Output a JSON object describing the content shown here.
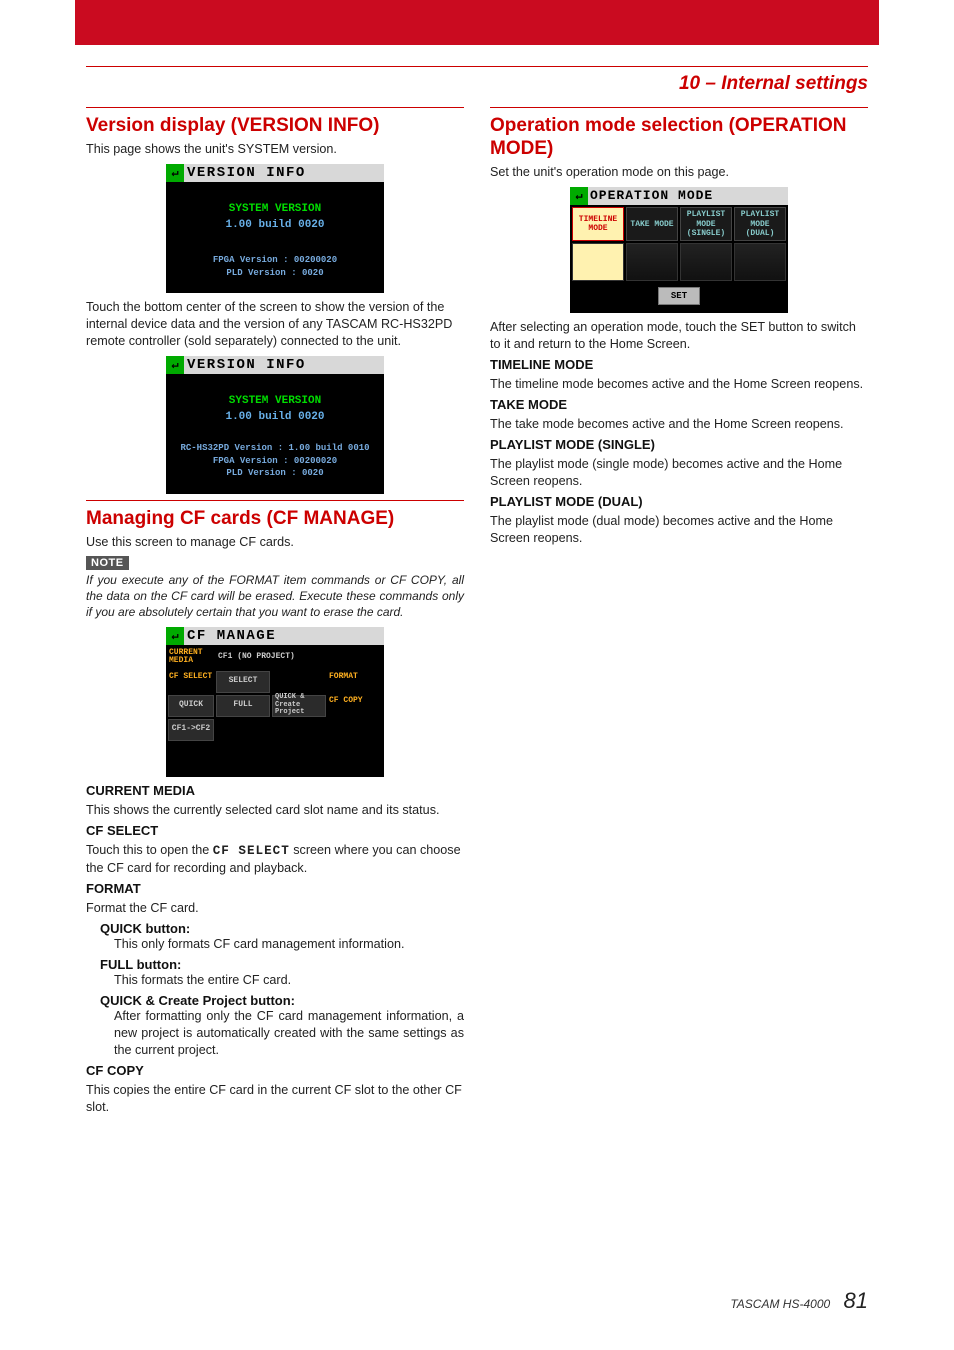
{
  "chapter": "10 – Internal settings",
  "s1": {
    "heading": "Version display (VERSION INFO)",
    "intro": "This page shows the unit's SYSTEM version.",
    "fig1": {
      "title": "VERSION INFO",
      "sys_label": "SYSTEM VERSION",
      "sys_value": "1.00 build 0020",
      "fpga": "FPGA Version : 00200020",
      "pld": "PLD Version : 0020"
    },
    "para2": "Touch the bottom center of the screen to show the version of the internal device data and the version of any TASCAM RC-HS32PD remote controller (sold separately) connected to the unit.",
    "fig2": {
      "title": "VERSION INFO",
      "sys_label": "SYSTEM VERSION",
      "sys_value": "1.00 build 0020",
      "rc": "RC-HS32PD Version : 1.00 build 0010",
      "fpga": "FPGA Version : 00200020",
      "pld": "PLD Version : 0020"
    }
  },
  "s2": {
    "heading": "Managing CF cards (CF MANAGE)",
    "intro": "Use this screen to manage CF cards.",
    "note_label": "NOTE",
    "note_body": "If you execute any of the FORMAT item commands or CF COPY, all the data on the CF card will be erased. Execute these commands only if you are absolutely certain that you want to erase the card.",
    "fig": {
      "title": "CF MANAGE",
      "row_current_label": "CURRENT MEDIA",
      "row_current_value": "CF1 (NO PROJECT)",
      "row_select_label": "CF SELECT",
      "row_select_btn": "SELECT",
      "row_format_label": "FORMAT",
      "row_format_quick": "QUICK",
      "row_format_full": "FULL",
      "row_format_qc": "QUICK & Create Project",
      "row_copy_label": "CF COPY",
      "row_copy_btn": "CF1->CF2"
    },
    "h_current": "CURRENT MEDIA",
    "p_current": "This shows the currently selected card slot name and its status.",
    "h_select": "CF SELECT",
    "p_select_a": "Touch this to open the ",
    "p_select_code": "CF SELECT",
    "p_select_b": " screen where you can choose the CF card for recording and playback.",
    "h_format": "FORMAT",
    "p_format": "Format the CF card.",
    "h_quick": "QUICK button:",
    "p_quick": "This only formats CF card management information.",
    "h_full": "FULL button:",
    "p_full": "This formats the entire CF card.",
    "h_qc": "QUICK & Create Project button:",
    "p_qc": "After formatting only the CF card management information, a new project is automatically created with the same settings as the current project.",
    "h_copy": "CF COPY",
    "p_copy": "This copies the entire CF card in the current CF slot to the other CF slot."
  },
  "s3": {
    "heading": "Operation mode selection (OPERATION MODE)",
    "intro": "Set the unit's operation mode on this page.",
    "fig": {
      "title": "OPERATION MODE",
      "timeline": "TIMELINE MODE",
      "take": "TAKE MODE",
      "pl_single_a": "PLAYLIST MODE",
      "pl_single_b": "(SINGLE)",
      "pl_dual_a": "PLAYLIST MODE",
      "pl_dual_b": "(DUAL)",
      "set": "SET"
    },
    "p_after": "After selecting an operation mode, touch the SET button to switch to it and return to the Home Screen.",
    "h_tl": "TIMELINE MODE",
    "p_tl": "The timeline mode becomes active and the Home Screen reopens.",
    "h_take": "TAKE MODE",
    "p_take": "The take mode becomes active and the Home Screen reopens.",
    "h_pls": "PLAYLIST MODE (SINGLE)",
    "p_pls": "The playlist mode (single mode) becomes active and the Home Screen reopens.",
    "h_pld": "PLAYLIST MODE (DUAL)",
    "p_pld": "The playlist mode (dual mode) becomes active and the Home Screen reopens."
  },
  "footer_model": "TASCAM  HS-4000",
  "footer_page": "81"
}
